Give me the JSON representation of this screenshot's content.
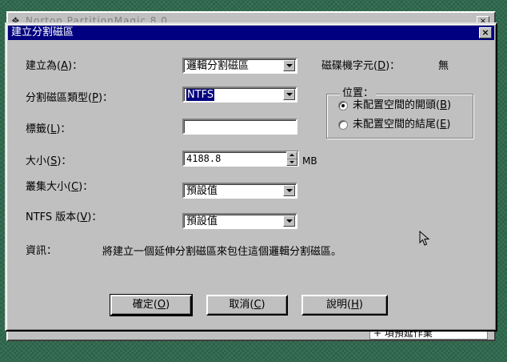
{
  "background_window": {
    "title": "Norton PartitionMagic 8.0",
    "bottom_item": "+ 項預延作業"
  },
  "dialog": {
    "title": "建立分割磁區",
    "close_glyph": "×"
  },
  "form": {
    "create_as": {
      "label": "建立為",
      "accel": "A",
      "value": "邏輯分割磁區"
    },
    "partition_type": {
      "label": "分割磁區類型",
      "accel": "P",
      "value": "NTFS"
    },
    "volume_label": {
      "label": "標籤",
      "accel": "L",
      "value": ""
    },
    "size": {
      "label": "大小",
      "accel": "S",
      "value": "4188.8",
      "unit": "MB"
    },
    "cluster_size": {
      "label": "叢集大小",
      "accel": "C",
      "value": "預設值"
    },
    "ntfs_version": {
      "label": "NTFS 版本",
      "accel": "V",
      "value": "預設值"
    },
    "drive_letter": {
      "label": "磁碟機字元",
      "accel": "D",
      "value": "無"
    }
  },
  "position_group": {
    "legend": "位置：",
    "options": [
      {
        "label": "未配置空間的開頭",
        "accel": "B",
        "checked": true
      },
      {
        "label": "未配置空間的結尾",
        "accel": "E",
        "checked": false
      }
    ]
  },
  "info": {
    "label": "資訊：",
    "text": "將建立一個延伸分割磁區來包住這個邏輯分割磁區。"
  },
  "buttons": {
    "ok": {
      "label": "確定",
      "accel": "O"
    },
    "cancel": {
      "label": "取消",
      "accel": "C"
    },
    "help": {
      "label": "說明",
      "accel": "H"
    }
  }
}
